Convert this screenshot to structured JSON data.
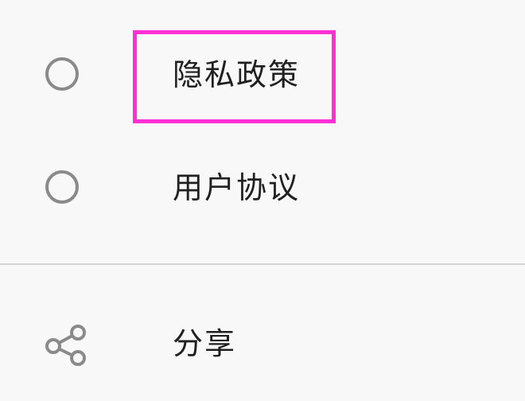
{
  "menu": {
    "items": [
      {
        "label": "隐私政策",
        "control": "radio",
        "selected": false,
        "highlighted": true
      },
      {
        "label": "用户协议",
        "control": "radio",
        "selected": false,
        "highlighted": false
      },
      {
        "label": "分享",
        "icon": "share-icon"
      }
    ]
  },
  "colors": {
    "background": "#f8f8f8",
    "text": "#202020",
    "icon": "#8a8a8a",
    "divider": "#d4d4d4",
    "highlight": "#ff2fd6"
  }
}
